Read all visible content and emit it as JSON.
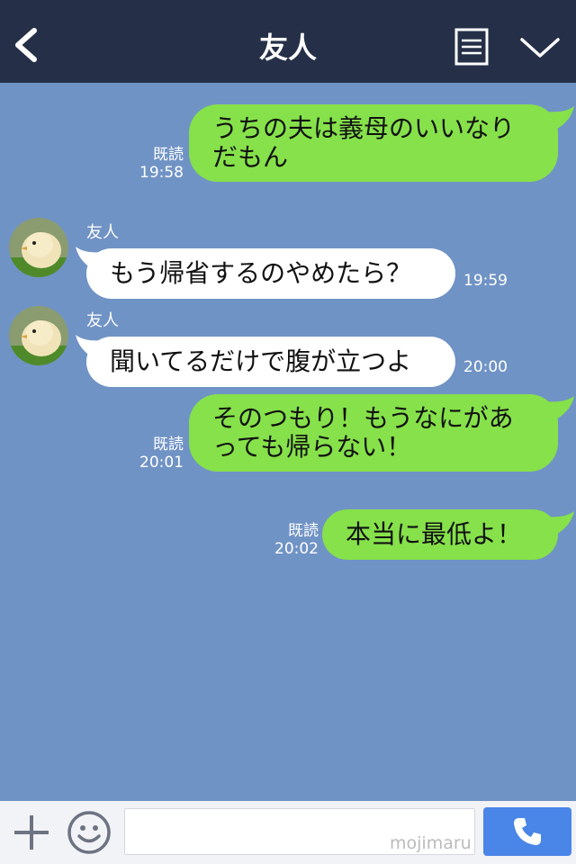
{
  "header": {
    "title": "友人",
    "background": "#253048"
  },
  "messages": [
    {
      "side": "me",
      "text_lines": [
        "うちの夫は義母のいいなり",
        "だもん"
      ],
      "read_label": "既読",
      "time": "19:58"
    },
    {
      "side": "friend",
      "sender": "友人",
      "text_lines": [
        "もう帰省するのやめたら？"
      ],
      "time": "19:59"
    },
    {
      "side": "friend",
      "sender": "友人",
      "text_lines": [
        "聞いてるだけで腹が立つよ"
      ],
      "time": "20:00"
    },
    {
      "side": "me",
      "text_lines": [
        "そのつもり！もうなにがあ",
        "っても帰らない！"
      ],
      "read_label": "既読",
      "time": "20:01"
    },
    {
      "side": "me",
      "text_lines": [
        "本当に最低よ！"
      ],
      "read_label": "既読",
      "time": "20:02"
    }
  ],
  "input": {
    "value": "",
    "watermark": "mojimaru"
  },
  "colors": {
    "chat_background": "#7093c5",
    "my_bubble": "#86e14a",
    "friend_bubble": "#ffffff",
    "call_button": "#4a86e8"
  },
  "icons": [
    "back-chevron-icon",
    "menu-icon",
    "chevron-down-icon",
    "avatar-chick",
    "plus-icon",
    "emoji-icon",
    "phone-icon"
  ]
}
